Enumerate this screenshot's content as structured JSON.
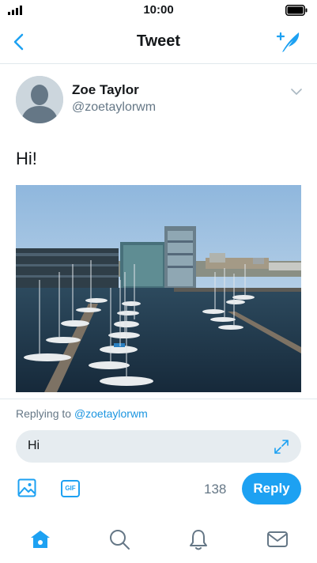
{
  "status_bar": {
    "time": "10:00",
    "signal_icon": "signal-icon",
    "battery_icon": "battery-icon"
  },
  "nav": {
    "title": "Tweet",
    "back_icon": "chevron-left-icon",
    "compose_icon": "compose-tweet-icon"
  },
  "tweet": {
    "author_name": "Zoe Taylor",
    "author_handle": "@zoetaylorwm",
    "text": "Hi!",
    "photo_icon": "harbor-photo"
  },
  "reply": {
    "replying_prefix": "Replying to ",
    "replying_handle": "@zoetaylorwm",
    "text": "Hi",
    "char_count": "138",
    "button_label": "Reply",
    "gif_label": "GIF"
  },
  "tabs": [
    {
      "name": "home",
      "icon": "home-icon",
      "active": true
    },
    {
      "name": "search",
      "icon": "search-icon",
      "active": false
    },
    {
      "name": "notifications",
      "icon": "bell-icon",
      "active": false
    },
    {
      "name": "messages",
      "icon": "mail-icon",
      "active": false
    }
  ],
  "colors": {
    "accent": "#1da1f2",
    "text": "#14171a",
    "muted": "#657786",
    "input_bg": "#e6ecf0"
  }
}
